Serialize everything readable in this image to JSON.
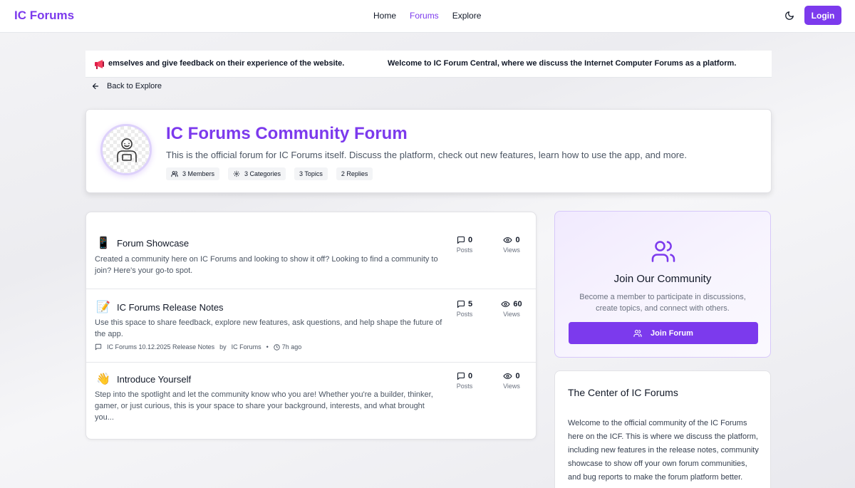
{
  "nav": {
    "brand": "IC Forums",
    "links": [
      "Home",
      "Forums",
      "Explore"
    ],
    "login_label": "Login"
  },
  "ticker": {
    "message_a": "emselves and give feedback on their experience of the website.",
    "message_b": "Welcome to IC Forum Central, where we discuss the Internet Computer Forums as a platform."
  },
  "back_label": "Back to Explore",
  "forum": {
    "title": "IC Forums Community Forum",
    "description": "This is the official forum for IC Forums itself. Discuss the platform, check out new features, learn how to use the app, and more.",
    "stats": [
      "3 Members",
      "3 Categories",
      "3 Topics",
      "2 Replies"
    ]
  },
  "categories": [
    {
      "emoji": "📱",
      "name": "Forum Showcase",
      "description": "Created a community here on IC Forums and looking to show it off? Looking to find a community to join? Here's your go-to spot.",
      "posts": "0",
      "posts_label": "Posts",
      "views": "0",
      "views_label": "Views"
    },
    {
      "emoji": "📝",
      "name": "IC Forums Release Notes",
      "description": "Use this space to share feedback, explore new features, ask questions, and help shape the future of the app.",
      "posts": "5",
      "posts_label": "Posts",
      "views": "60",
      "views_label": "Views",
      "latest": {
        "title": "IC Forums 10.12.2025 Release Notes",
        "by": "by",
        "author": "IC Forums",
        "sep": "•",
        "time": "7h ago"
      }
    },
    {
      "emoji": "👋",
      "name": "Introduce Yourself",
      "description": "Step into the spotlight and let the community know who you are! Whether you're a builder, thinker, gamer, or just curious, this is your space to share your background, interests, and what brought you...",
      "posts": "0",
      "posts_label": "Posts",
      "views": "0",
      "views_label": "Views"
    }
  ],
  "join": {
    "title": "Join Our Community",
    "description": "Become a member to participate in discussions, create topics, and connect with others.",
    "button_label": "Join Forum"
  },
  "about": {
    "title": "The Center of IC Forums",
    "text": "Welcome to the official community of the IC Forums here on the ICF. This is where we discuss the platform, including new features in the release notes, community showcase to show off your own forum communities, and bug reports to make the forum platform better."
  },
  "colors": {
    "accent": "#7c3aed",
    "accent_light": "#f1eafe",
    "border": "#e5e7eb",
    "text": "#111827",
    "muted": "#4b5563"
  },
  "icons": {
    "theme_toggle": "moon-icon",
    "ticker": "megaphone-icon",
    "back": "arrow-left-icon",
    "members": "users-icon",
    "categories": "gear-icon",
    "posts": "message-square-icon",
    "views": "eye-icon",
    "latest": "message-square-icon",
    "time": "clock-icon",
    "join": "users-icon"
  }
}
